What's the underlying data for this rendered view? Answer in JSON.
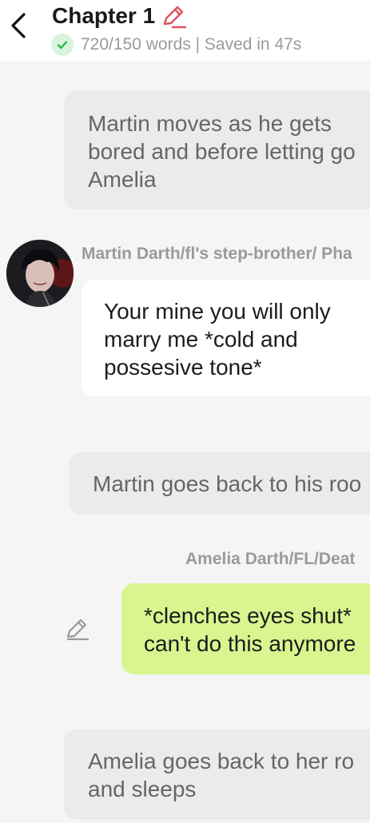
{
  "header": {
    "title": "Chapter 1",
    "status": "720/150 words | Saved in 47s",
    "back_icon": "chevron-left-icon",
    "edit_icon": "pencil-icon"
  },
  "messages": [
    {
      "type": "narration",
      "lines": [
        "Martin moves as he gets",
        "bored and before letting go",
        "Amelia"
      ]
    },
    {
      "type": "character",
      "name": "Martin Darth/fl's step-brother/ Pha",
      "lines": [
        "Your mine you will only",
        "marry me *cold and",
        "possesive tone*"
      ]
    },
    {
      "type": "narration",
      "lines": [
        "Martin goes back to his roo"
      ]
    },
    {
      "type": "main-character",
      "name": "Amelia Darth/FL/Deat",
      "lines": [
        "*clenches eyes shut*",
        "can't do this anymore"
      ]
    },
    {
      "type": "narration",
      "lines": [
        "Amelia goes back to her ro",
        "and sleeps"
      ]
    }
  ],
  "colors": {
    "accent_red": "#e0505c",
    "check_green": "#2eb84c",
    "main_bubble": "#d8f58f",
    "narration_bubble": "#ebebeb"
  }
}
